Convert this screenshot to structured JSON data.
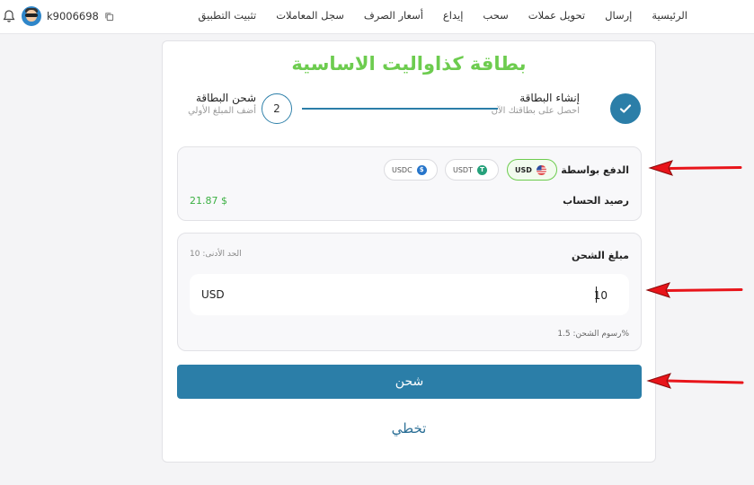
{
  "nav": {
    "items": [
      "الرئيسية",
      "إرسال",
      "تحويل عملات",
      "سحب",
      "إيداع",
      "أسعار الصرف",
      "سجل المعاملات",
      "تثبيت التطبيق"
    ]
  },
  "user": {
    "username": "k9006698"
  },
  "card": {
    "title": "بطاقة كذاواليت الاساسية",
    "steps": [
      {
        "number": "",
        "title": "إنشاء البطاقة",
        "subtitle": "احصل على بطاقتك الآن",
        "status": "done"
      },
      {
        "number": "2",
        "title": "شحن البطاقة",
        "subtitle": "أضف المبلغ الأولي",
        "status": "current"
      }
    ],
    "payment": {
      "label": "الدفع بواسطة",
      "options": [
        {
          "label": "USD",
          "selected": true
        },
        {
          "label": "USDT",
          "selected": false
        },
        {
          "label": "USDC",
          "selected": false
        }
      ],
      "balance_label": "رصيد الحساب",
      "balance_value": "21.87 $"
    },
    "amount": {
      "label": "مبلغ الشحن",
      "min_label": "الحد الأدنى: 10",
      "currency": "USD",
      "value": "10",
      "fee_label": "رسوم الشحن: 1.5%"
    },
    "charge_button": "شحن",
    "skip_link": "تخطي"
  },
  "colors": {
    "primary": "#2b7ea8",
    "accent_green": "#6dcc4f",
    "annotation_arrow": "#e8141a"
  }
}
